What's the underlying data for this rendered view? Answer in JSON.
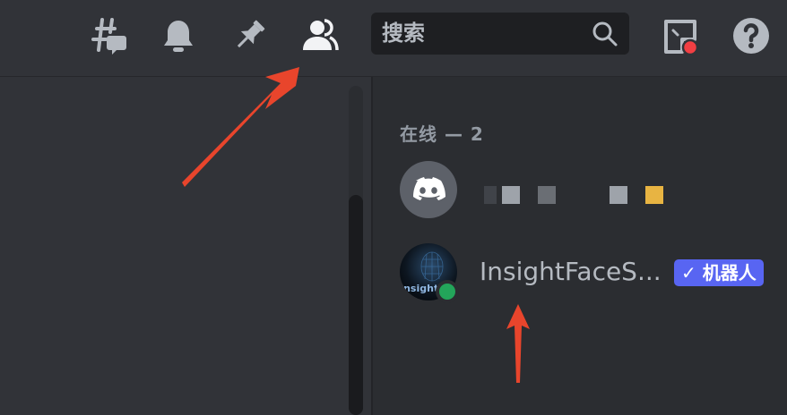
{
  "toolbar": {
    "icons": [
      "threads-icon",
      "bell-icon",
      "pin-icon",
      "members-icon"
    ],
    "search_placeholder": "搜索",
    "inbox_icon": "inbox-icon",
    "help_icon": "help-icon"
  },
  "members": {
    "section_header": "在线 — 2",
    "list": [
      {
        "name": "",
        "avatar": "discord-logo"
      },
      {
        "name": "InsightFaceS...",
        "avatar_text": "Insight",
        "status": "online",
        "tag": "✓ 机器人"
      }
    ]
  },
  "colors": {
    "background": "#313338",
    "panel": "#2b2d31",
    "bot_tag": "#5865f2",
    "online": "#23a55a",
    "annotation_arrow": "#e8452c"
  }
}
